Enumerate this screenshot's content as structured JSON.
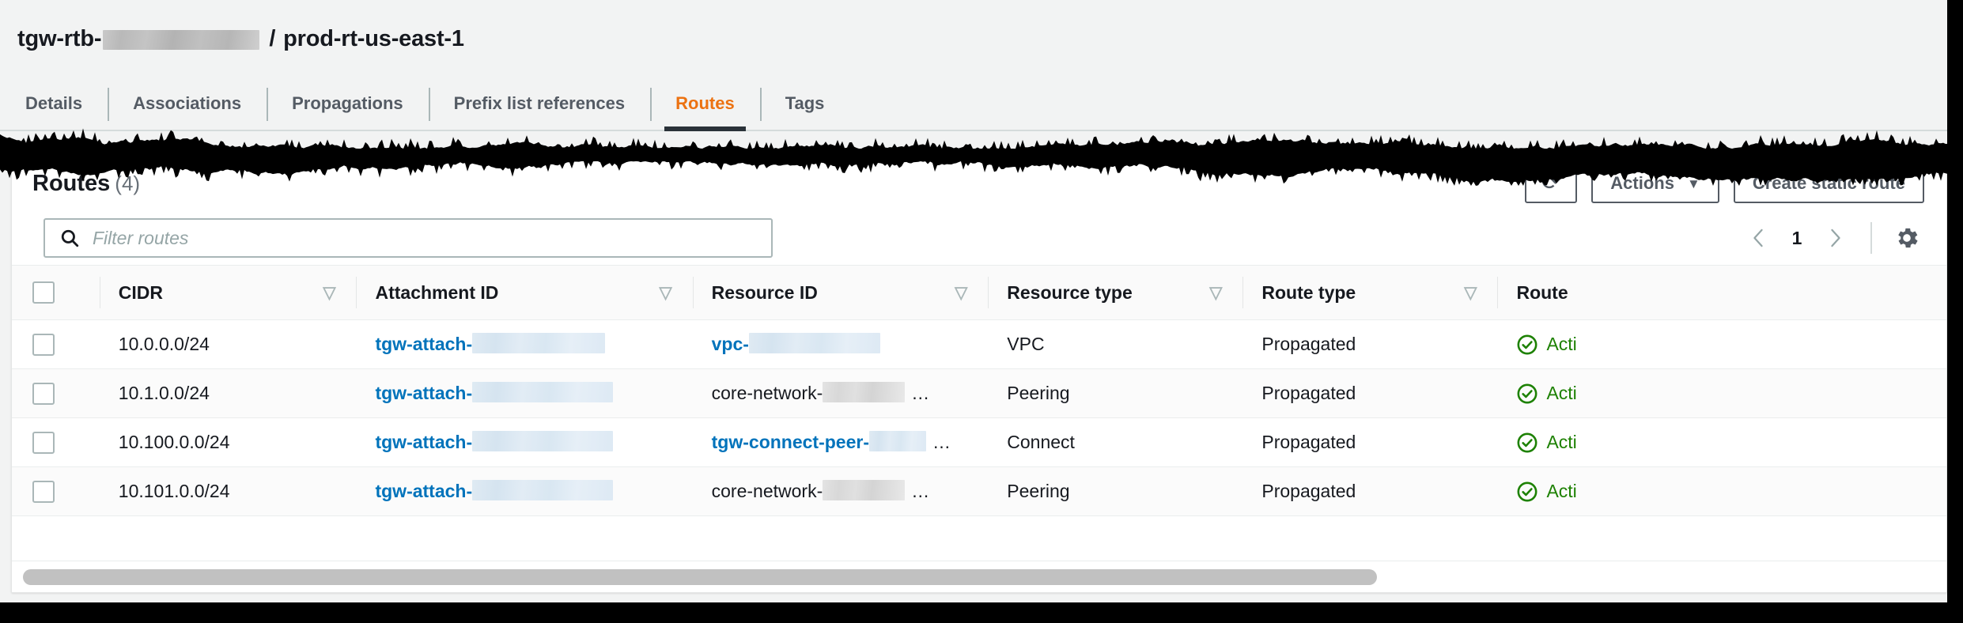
{
  "header": {
    "resource_prefix": "tgw-rtb-",
    "redacted_id": "",
    "separator": "/",
    "resource_name": "prod-rt-us-east-1"
  },
  "tabs": [
    {
      "label": "Details",
      "active": false
    },
    {
      "label": "Associations",
      "active": false
    },
    {
      "label": "Propagations",
      "active": false
    },
    {
      "label": "Prefix list references",
      "active": false
    },
    {
      "label": "Routes",
      "active": true
    },
    {
      "label": "Tags",
      "active": false
    }
  ],
  "panel": {
    "title": "Routes",
    "count": "(4)",
    "refresh_icon": "refresh-icon",
    "actions_label": "Actions",
    "actions_caret": "▼",
    "create_label": "Create static route"
  },
  "search": {
    "icon": "search-icon",
    "placeholder": "Filter routes",
    "value": ""
  },
  "pagination": {
    "prev_icon": "chevron-left-icon",
    "page": "1",
    "next_icon": "chevron-right-icon",
    "settings_icon": "gear-icon"
  },
  "table": {
    "select_all": "select-all-checkbox",
    "sort_glyph": "▽",
    "columns": [
      {
        "label": "CIDR",
        "sortable": true
      },
      {
        "label": "Attachment ID",
        "sortable": true
      },
      {
        "label": "Resource ID",
        "sortable": true
      },
      {
        "label": "Resource type",
        "sortable": true
      },
      {
        "label": "Route type",
        "sortable": true
      },
      {
        "label": "Route",
        "sortable": false
      }
    ],
    "rows": [
      {
        "cidr": "10.0.0.0/24",
        "attachment_prefix": "tgw-attach-",
        "attachment_redacted": true,
        "attachment_redact_width": 168,
        "resource_prefix": "vpc-",
        "resource_is_link": true,
        "resource_redact_width": 166,
        "resource_truncated": false,
        "resource_type": "VPC",
        "route_type": "Propagated",
        "state": "Acti",
        "state_icon": "check-circle-icon"
      },
      {
        "cidr": "10.1.0.0/24",
        "attachment_prefix": "tgw-attach-",
        "attachment_redacted": true,
        "attachment_redact_width": 178,
        "resource_prefix": "core-network-",
        "resource_is_link": false,
        "resource_redact_width": 104,
        "resource_truncated": true,
        "resource_type": "Peering",
        "route_type": "Propagated",
        "state": "Acti",
        "state_icon": "check-circle-icon"
      },
      {
        "cidr": "10.100.0.0/24",
        "attachment_prefix": "tgw-attach-",
        "attachment_redacted": true,
        "attachment_redact_width": 178,
        "resource_prefix": "tgw-connect-peer-",
        "resource_is_link": true,
        "resource_redact_width": 72,
        "resource_truncated": true,
        "resource_type": "Connect",
        "route_type": "Propagated",
        "state": "Acti",
        "state_icon": "check-circle-icon"
      },
      {
        "cidr": "10.101.0.0/24",
        "attachment_prefix": "tgw-attach-",
        "attachment_redacted": true,
        "attachment_redact_width": 178,
        "resource_prefix": "core-network-",
        "resource_is_link": false,
        "resource_redact_width": 104,
        "resource_truncated": true,
        "resource_type": "Peering",
        "route_type": "Propagated",
        "state": "Acti",
        "state_icon": "check-circle-icon"
      }
    ],
    "ellipsis": "…"
  },
  "scrollbar": {
    "name": "horizontal-scrollbar"
  },
  "colors": {
    "accent_orange": "#ec7211",
    "link_blue": "#0073bb",
    "status_green": "#1d8102",
    "text_dark": "#16191f",
    "text_muted": "#545b64",
    "canvas": "#f2f3f3"
  }
}
